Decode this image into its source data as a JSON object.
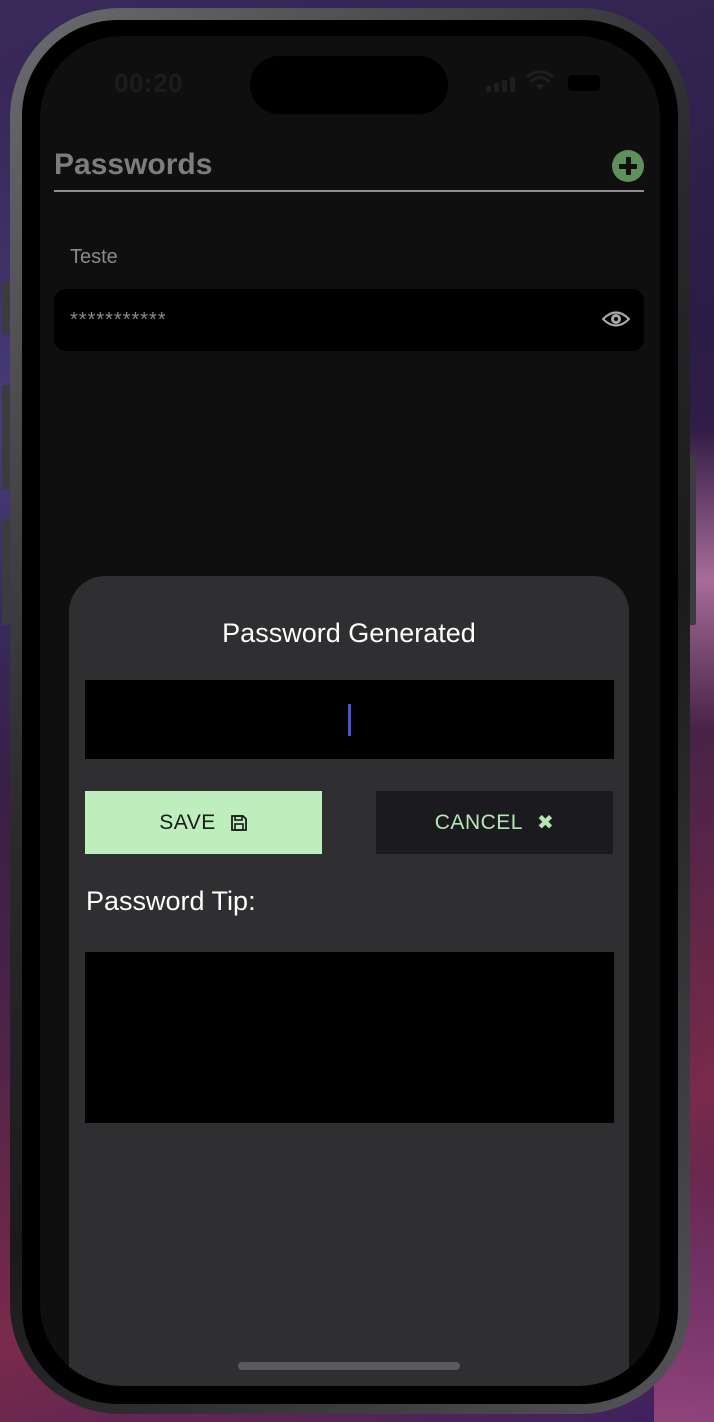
{
  "status_bar": {
    "time": "00:20"
  },
  "header": {
    "title": "Passwords",
    "add_icon": "plus-circle-icon"
  },
  "entries": [
    {
      "label": "Teste",
      "masked_value": "***********",
      "reveal_icon": "eye-icon"
    }
  ],
  "generated_sheet": {
    "title": "Password Generated",
    "password_value": "",
    "save_label": "SAVE",
    "save_icon": "floppy-disk-icon",
    "cancel_label": "CANCEL",
    "cancel_icon": "close-x-icon",
    "tip_label": "Password Tip:",
    "tip_value": ""
  },
  "colors": {
    "accent_green": "#bdeebb",
    "add_button_green": "#5f8f5a",
    "cursor_blue": "#4a52d0",
    "sheet_background": "#2f2f31",
    "screen_background": "#0f0f10"
  }
}
